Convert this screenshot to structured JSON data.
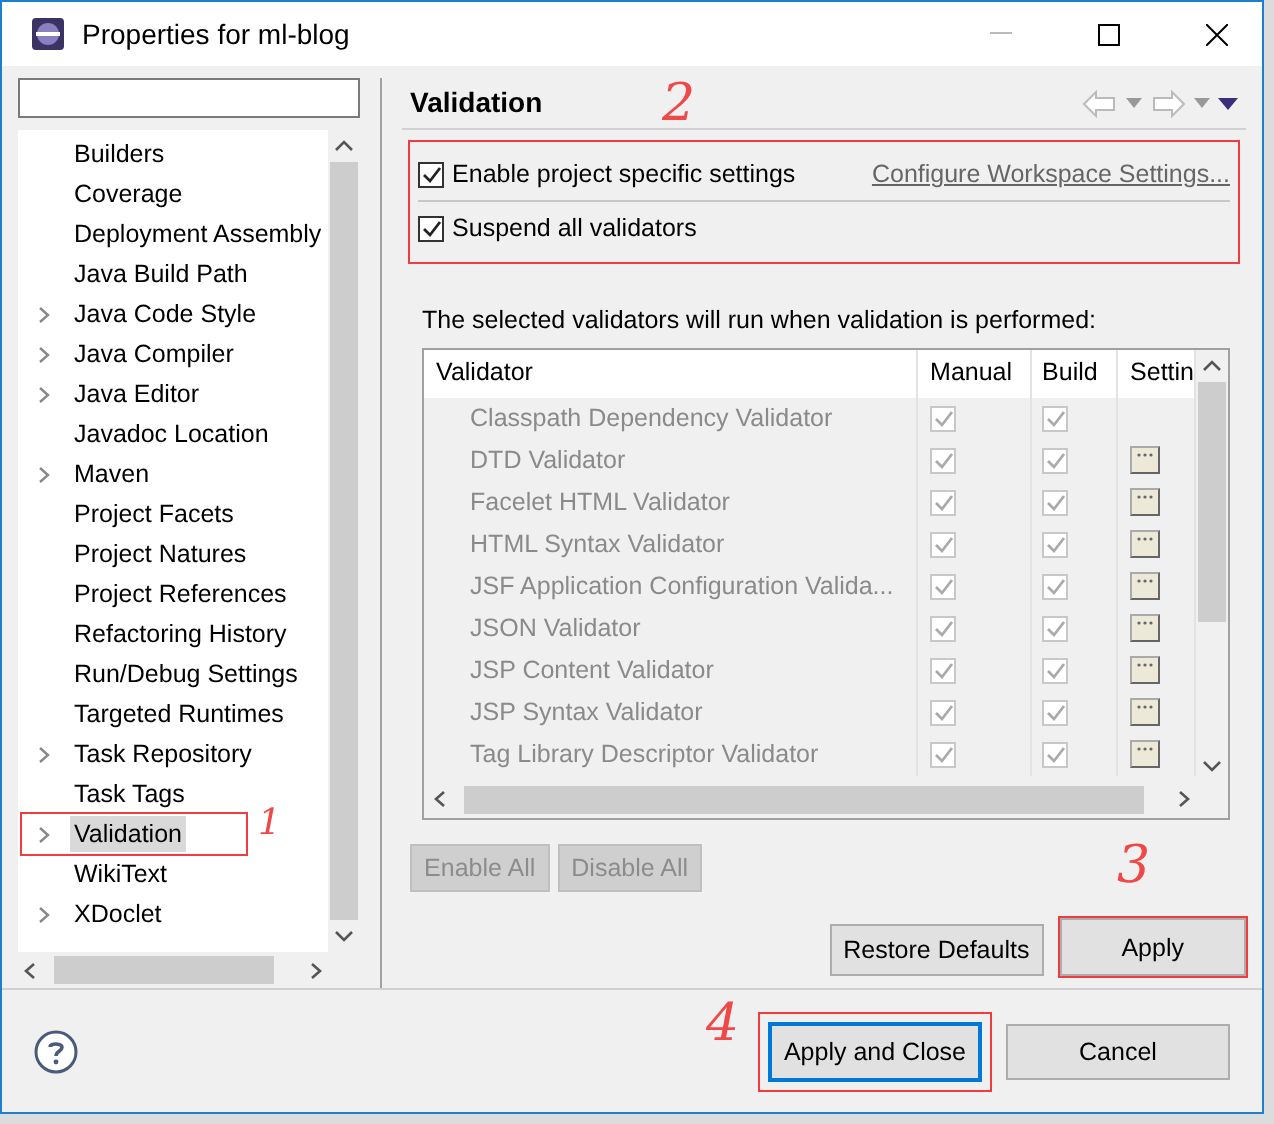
{
  "window": {
    "title": "Properties for ml-blog"
  },
  "tree": [
    {
      "label": "Builders",
      "expandable": false,
      "selected": false
    },
    {
      "label": "Coverage",
      "expandable": false,
      "selected": false
    },
    {
      "label": "Deployment Assembly",
      "expandable": false,
      "selected": false
    },
    {
      "label": "Java Build Path",
      "expandable": false,
      "selected": false
    },
    {
      "label": "Java Code Style",
      "expandable": true,
      "selected": false
    },
    {
      "label": "Java Compiler",
      "expandable": true,
      "selected": false
    },
    {
      "label": "Java Editor",
      "expandable": true,
      "selected": false
    },
    {
      "label": "Javadoc Location",
      "expandable": false,
      "selected": false
    },
    {
      "label": "Maven",
      "expandable": true,
      "selected": false
    },
    {
      "label": "Project Facets",
      "expandable": false,
      "selected": false
    },
    {
      "label": "Project Natures",
      "expandable": false,
      "selected": false
    },
    {
      "label": "Project References",
      "expandable": false,
      "selected": false
    },
    {
      "label": "Refactoring History",
      "expandable": false,
      "selected": false
    },
    {
      "label": "Run/Debug Settings",
      "expandable": false,
      "selected": false
    },
    {
      "label": "Targeted Runtimes",
      "expandable": false,
      "selected": false
    },
    {
      "label": "Task Repository",
      "expandable": true,
      "selected": false
    },
    {
      "label": "Task Tags",
      "expandable": false,
      "selected": false
    },
    {
      "label": "Validation",
      "expandable": true,
      "selected": true,
      "annotation": "1"
    },
    {
      "label": "WikiText",
      "expandable": false,
      "selected": false
    },
    {
      "label": "XDoclet",
      "expandable": true,
      "selected": false
    }
  ],
  "page": {
    "title": "Validation",
    "annotation": "2",
    "options": [
      {
        "label": "Enable project specific settings",
        "checked": true
      },
      {
        "label": "Suspend all validators",
        "checked": true
      }
    ],
    "link": "Configure Workspace Settings...",
    "description": "The selected validators will run when validation is performed:",
    "table": {
      "disabled": true,
      "columns": [
        "Validator",
        "Manual",
        "Build",
        "Settin"
      ],
      "rows": [
        {
          "name": "Classpath Dependency Validator",
          "manual": true,
          "build": true,
          "has_settings": false
        },
        {
          "name": "DTD Validator",
          "manual": true,
          "build": true,
          "has_settings": true
        },
        {
          "name": "Facelet HTML Validator",
          "manual": true,
          "build": true,
          "has_settings": true
        },
        {
          "name": "HTML Syntax Validator",
          "manual": true,
          "build": true,
          "has_settings": true
        },
        {
          "name": "JSF Application Configuration Valida...",
          "manual": true,
          "build": true,
          "has_settings": true
        },
        {
          "name": "JSON Validator",
          "manual": true,
          "build": true,
          "has_settings": true
        },
        {
          "name": "JSP Content Validator",
          "manual": true,
          "build": true,
          "has_settings": true
        },
        {
          "name": "JSP Syntax Validator",
          "manual": true,
          "build": true,
          "has_settings": true
        },
        {
          "name": "Tag Library Descriptor Validator",
          "manual": true,
          "build": true,
          "has_settings": true
        }
      ]
    },
    "table_buttons": [
      {
        "label": "Enable All",
        "disabled": true
      },
      {
        "label": "Disable All",
        "disabled": true
      }
    ],
    "buttons": [
      {
        "label": "Restore Defaults"
      },
      {
        "label": "Apply",
        "annotation": "3"
      }
    ]
  },
  "footer_buttons": [
    {
      "label": "Apply and Close",
      "default": true,
      "annotation": "4"
    },
    {
      "label": "Cancel",
      "default": false
    }
  ]
}
